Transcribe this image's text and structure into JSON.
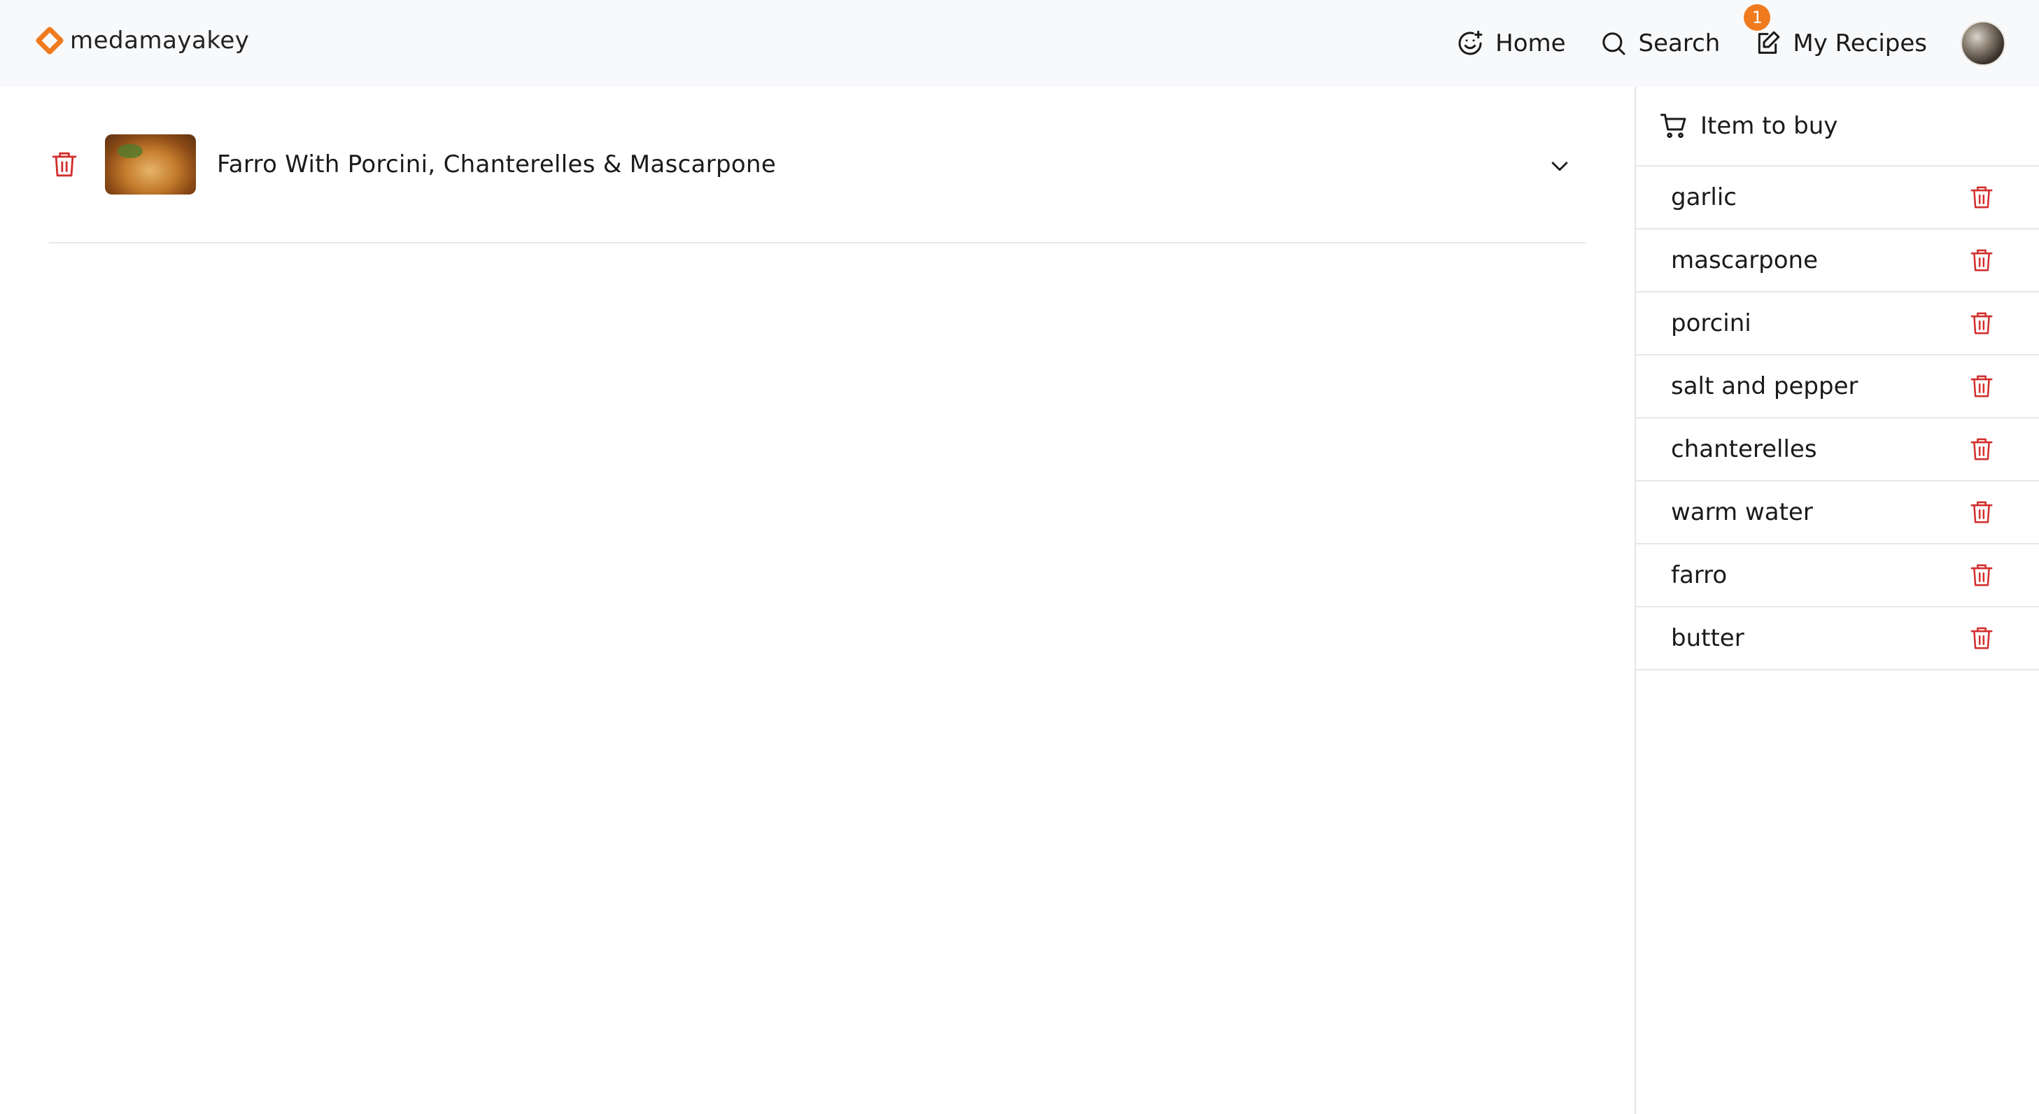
{
  "brand": {
    "name": "medamayakey",
    "accent": "#f07b1e"
  },
  "nav": {
    "home": "Home",
    "search": "Search",
    "my_recipes": "My Recipes",
    "my_recipes_badge": "1"
  },
  "recipes": [
    {
      "title": "Farro With Porcini, Chanterelles & Mascarpone"
    }
  ],
  "shopping": {
    "title": "Item to buy",
    "items": [
      "garlic",
      "mascarpone",
      "porcini",
      "salt and pepper",
      "chanterelles",
      "warm water",
      "farro",
      "butter"
    ]
  },
  "colors": {
    "delete": "#d32f2f",
    "divider": "#e7e7e7",
    "header_bg": "#f8f9fb"
  },
  "icons": [
    "smile-plus-icon",
    "search-icon",
    "edit-note-icon",
    "trash-icon",
    "chevron-down-icon",
    "cart-icon"
  ]
}
